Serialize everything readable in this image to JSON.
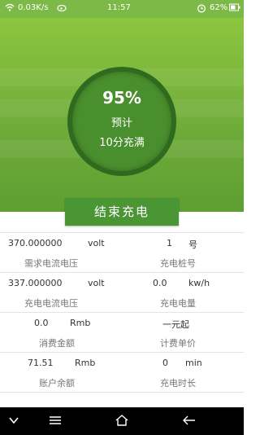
{
  "status_bar": {
    "speed": "0.03K/s",
    "time": "11:57",
    "battery": "62%",
    "icons": [
      "wifi-icon",
      "weibo-icon",
      "alarm-icon",
      "battery-icon"
    ]
  },
  "charging": {
    "percent": "95%",
    "estimate_label": "预计",
    "remaining": "10分充满"
  },
  "end_button_label": "结束充电",
  "rows": [
    {
      "left_value": "370.000000",
      "left_unit": "volt",
      "left_label": "需求电流电压",
      "right_value": "1",
      "right_unit": "号",
      "right_label": "充电桩号"
    },
    {
      "left_value": "337.000000",
      "left_unit": "volt",
      "left_label": "充电电流电压",
      "right_value": "0.0",
      "right_unit": "kw/h",
      "right_label": "充电电量"
    },
    {
      "left_value": "0.0",
      "left_unit": "Rmb",
      "left_label": "消费金额",
      "right_value": "一元起",
      "right_unit": "",
      "right_label": "计费单价"
    },
    {
      "left_value": "71.51",
      "left_unit": "Rmb",
      "left_label": "账户余额",
      "right_value": "0",
      "right_unit": "min",
      "right_label": "充电时长"
    }
  ],
  "nav": {
    "icons": [
      "chevron-down-icon",
      "menu-icon",
      "home-icon",
      "back-icon"
    ]
  },
  "colors": {
    "accent": "#7cb947",
    "button": "#4a9635",
    "circle": "#4a8f2d"
  }
}
